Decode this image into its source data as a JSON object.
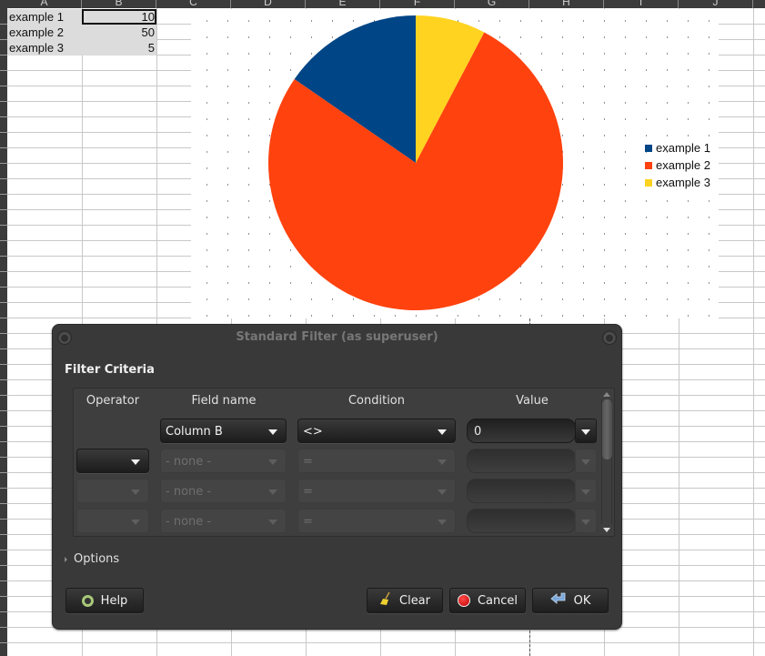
{
  "spreadsheet": {
    "columns": [
      "A",
      "B",
      "C",
      "D",
      "E",
      "F",
      "G",
      "H",
      "I",
      "J"
    ],
    "rows": [
      {
        "label": "example 1",
        "value": "10"
      },
      {
        "label": "example 2",
        "value": "50"
      },
      {
        "label": "example 3",
        "value": "5"
      }
    ]
  },
  "chart_data": {
    "type": "pie",
    "title": "",
    "categories": [
      "example 1",
      "example 2",
      "example 3"
    ],
    "values": [
      10,
      50,
      5
    ],
    "colors": [
      "#004586",
      "#ff420e",
      "#ffd320"
    ],
    "legend": "right",
    "start_angle": "12 o'clock",
    "direction": "counter-clockwise"
  },
  "dialog": {
    "title": "Standard Filter (as superuser)",
    "section_title": "Filter Criteria",
    "headers": {
      "operator": "Operator",
      "field_name": "Field name",
      "condition": "Condition",
      "value": "Value"
    },
    "criteria": [
      {
        "operator": "",
        "field": "Column B",
        "condition": "<>",
        "value": "0",
        "enabled": true
      },
      {
        "operator": "",
        "field": "- none -",
        "condition": "=",
        "value": "",
        "enabled": false
      },
      {
        "operator": "",
        "field": "- none -",
        "condition": "=",
        "value": "",
        "enabled": false
      },
      {
        "operator": "",
        "field": "- none -",
        "condition": "=",
        "value": "",
        "enabled": false
      }
    ],
    "options_label": "Options",
    "buttons": {
      "help": "Help",
      "clear": "Clear",
      "cancel": "Cancel",
      "ok": "OK"
    }
  }
}
